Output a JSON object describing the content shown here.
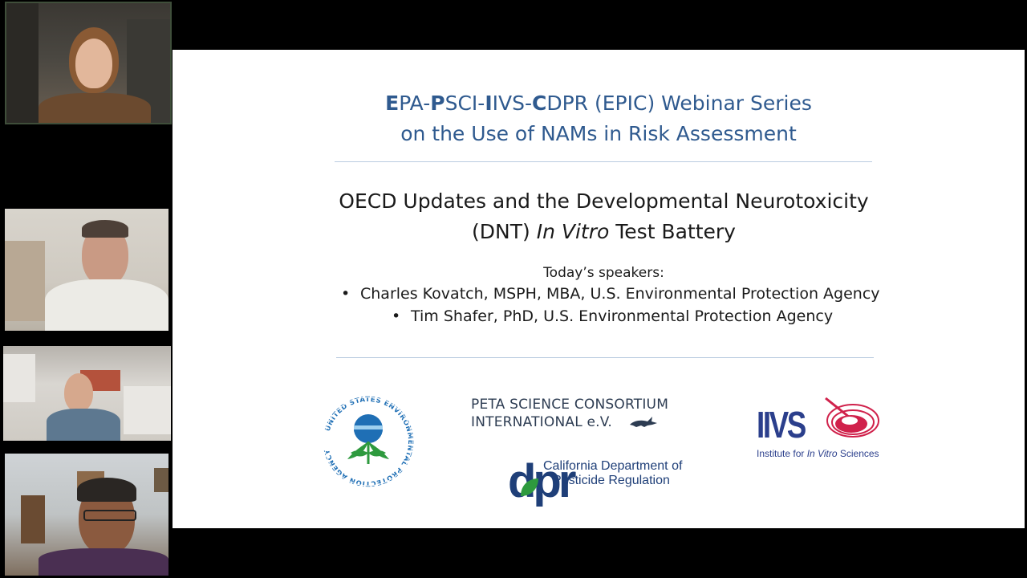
{
  "slide": {
    "title_line1_parts": [
      {
        "t": "E",
        "b": true
      },
      {
        "t": "PA-",
        "b": false
      },
      {
        "t": "P",
        "b": true
      },
      {
        "t": "SCI-",
        "b": false
      },
      {
        "t": "I",
        "b": true
      },
      {
        "t": "IVS-",
        "b": false
      },
      {
        "t": "C",
        "b": true
      },
      {
        "t": "DPR (EPIC) Webinar Series",
        "b": false
      }
    ],
    "title_line2": "on the Use of NAMs in Risk Assessment",
    "subtitle_line1": "OECD Updates and the Developmental Neurotoxicity",
    "subtitle_line2_pre": "(DNT) ",
    "subtitle_line2_italic": "In Vitro",
    "subtitle_line2_post": " Test Battery",
    "speakers_heading": "Today’s speakers:",
    "speakers": [
      "Charles Kovatch, MSPH, MBA, U.S. Environmental Protection Agency",
      "Tim Shafer, PhD, U.S. Environmental Protection Agency"
    ],
    "bullet": "•"
  },
  "logos": {
    "epa_arc": "UNITED STATES ENVIRONMENTAL PROTECTION AGENCY",
    "peta_line1": "PETA SCIENCE CONSORTIUM",
    "peta_line2": "INTERNATIONAL e.V.",
    "iivs_letters": "IIVS",
    "iivs_caption_pre": "Institute for ",
    "iivs_caption_italic": "In Vitro",
    "iivs_caption_post": " Sciences",
    "dpr_mark": "dpr",
    "dpr_line1": "California Department of",
    "dpr_line2": "Pesticide Regulation"
  },
  "colors": {
    "title_blue": "#2f5a8f",
    "epa_green": "#2e9a3e",
    "epa_blue": "#1f6fb5",
    "iivs_blue": "#2b3f8c",
    "iivs_red": "#d0214b",
    "dpr_blue": "#1f3f78"
  }
}
